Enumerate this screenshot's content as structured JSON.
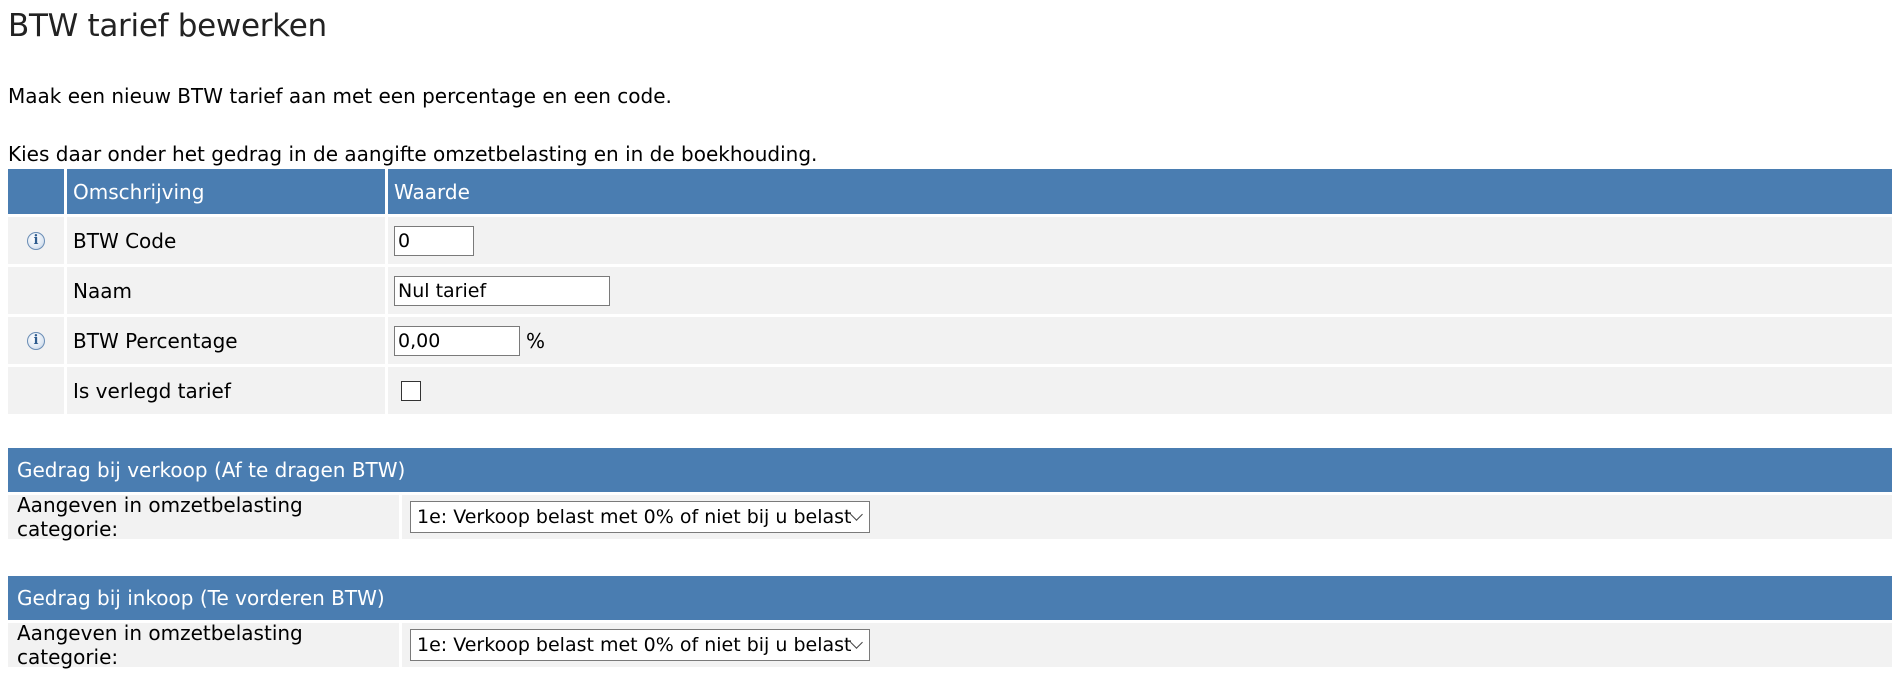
{
  "page": {
    "title": "BTW tarief bewerken",
    "intro_line1": "Maak een nieuw BTW tarief aan met een percentage en een code.",
    "intro_line2": "Kies daar onder het gedrag in de aangifte omzetbelasting en in de boekhouding."
  },
  "table": {
    "headers": {
      "icon": "",
      "omschrijving": "Omschrijving",
      "waarde": "Waarde"
    },
    "rows": {
      "btw_code": {
        "label": "BTW Code",
        "value": "0",
        "has_info": true
      },
      "naam": {
        "label": "Naam",
        "value": "Nul tarief",
        "has_info": false
      },
      "btw_percentage": {
        "label": "BTW Percentage",
        "value": "0,00",
        "unit": "%",
        "has_info": true
      },
      "verlegd": {
        "label": "Is verlegd tarief",
        "checked": false,
        "has_info": false
      }
    }
  },
  "verkoop": {
    "heading": "Gedrag bij verkoop (Af te dragen BTW)",
    "label": "Aangeven in omzetbelasting categorie:",
    "selected": "1e: Verkoop belast met 0% of niet bij u belast"
  },
  "inkoop": {
    "heading": "Gedrag bij inkoop (Te vorderen BTW)",
    "label": "Aangeven in omzetbelasting categorie:",
    "selected": "1e: Verkoop belast met 0% of niet bij u belast"
  },
  "icons": {
    "info": "info-icon",
    "dropdown": "chevron-down-icon"
  },
  "colors": {
    "header_bg": "#4a7db1",
    "row_bg": "#f2f2f2"
  }
}
